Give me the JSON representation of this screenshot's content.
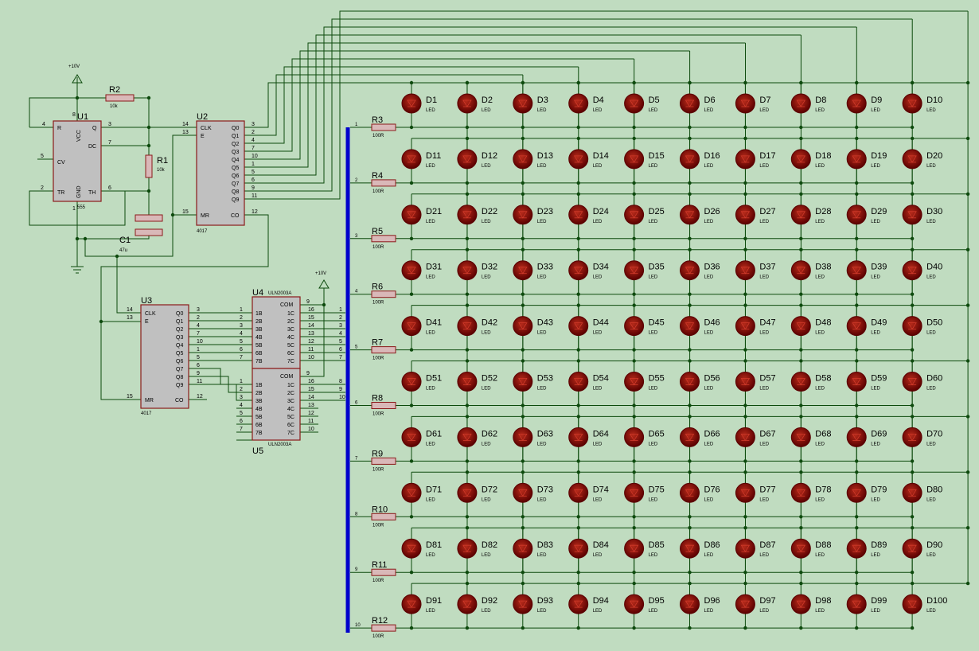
{
  "colors": {
    "background": "#c0dcc0",
    "wire": "#0d4a0d",
    "chip_fill": "#c0c0c0",
    "chip_border": "#8b1a1a",
    "bus": "#0000cc",
    "led_body": "#8b0000",
    "resistor_fill": "#d9b8b8"
  },
  "supply_label": "+10V",
  "ic555": {
    "ref": "U1",
    "part": "555",
    "pins": {
      "vcc": "VCC",
      "r": "R",
      "q": "Q",
      "dc": "DC",
      "cv": "CV",
      "tr": "TR",
      "th": "TH",
      "gnd": "GND"
    },
    "pin_numbers": {
      "r": "4",
      "vcc": "8",
      "q": "3",
      "dc": "7",
      "cv": "5",
      "tr": "2",
      "th": "6",
      "gnd": "1"
    }
  },
  "r2": {
    "ref": "R2",
    "value": "10k"
  },
  "r1": {
    "ref": "R1",
    "value": "10k"
  },
  "c1": {
    "ref": "C1",
    "value": "47u"
  },
  "counter_pins": {
    "clk": "CLK",
    "e": "E",
    "mr": "MR",
    "co": "CO",
    "outputs": [
      "Q0",
      "Q1",
      "Q2",
      "Q3",
      "Q4",
      "Q5",
      "Q6",
      "Q7",
      "Q8",
      "Q9"
    ],
    "output_numbers": [
      "3",
      "2",
      "4",
      "7",
      "10",
      "1",
      "5",
      "6",
      "9",
      "11"
    ],
    "clk_pin": "14",
    "e_pin": "13",
    "mr_pin": "15",
    "co_pin": "12"
  },
  "u2": {
    "ref": "U2",
    "part": "4017"
  },
  "u3": {
    "ref": "U3",
    "part": "4017"
  },
  "u4": {
    "ref": "U4",
    "part": "ULN2003A"
  },
  "u5": {
    "ref": "U5",
    "part": "ULN2003A"
  },
  "uln_pins": {
    "inputs": [
      "1B",
      "2B",
      "3B",
      "4B",
      "5B",
      "6B",
      "7B"
    ],
    "outputs": [
      "1C",
      "2C",
      "3C",
      "4C",
      "5C",
      "6C",
      "7C"
    ],
    "com": "COM",
    "input_numbers": [
      "1",
      "2",
      "3",
      "4",
      "5",
      "6",
      "7"
    ],
    "output_numbers": [
      "16",
      "15",
      "14",
      "13",
      "12",
      "11",
      "10"
    ],
    "com_number": "9"
  },
  "bus_numbers": [
    "1",
    "2",
    "3",
    "4",
    "5",
    "6",
    "7",
    "8",
    "9",
    "10"
  ],
  "row_resistors": [
    {
      "ref": "R3",
      "value": "100R"
    },
    {
      "ref": "R4",
      "value": "100R"
    },
    {
      "ref": "R5",
      "value": "100R"
    },
    {
      "ref": "R6",
      "value": "100R"
    },
    {
      "ref": "R7",
      "value": "100R"
    },
    {
      "ref": "R8",
      "value": "100R"
    },
    {
      "ref": "R9",
      "value": "100R"
    },
    {
      "ref": "R10",
      "value": "100R"
    },
    {
      "ref": "R11",
      "value": "100R"
    },
    {
      "ref": "R12",
      "value": "100R"
    }
  ],
  "led_matrix": {
    "rows": 10,
    "cols": 10,
    "ref_prefix": "D",
    "type_label": "LED"
  }
}
